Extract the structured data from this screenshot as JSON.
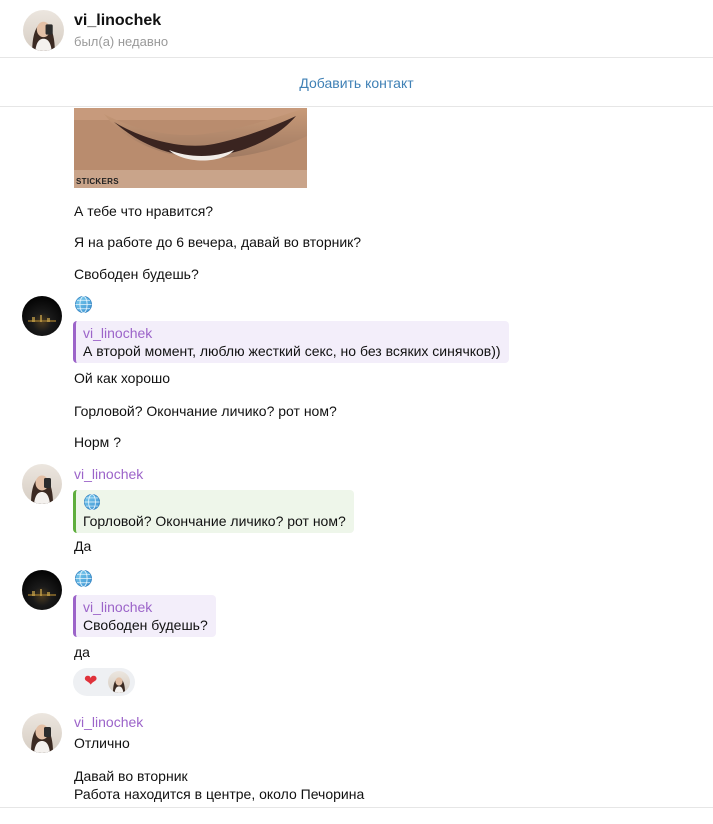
{
  "header": {
    "name": "vi_linochek",
    "status": "был(а) недавно"
  },
  "add_contact_label": "Добавить контакт",
  "sticker": {
    "caption": "STICKERS"
  },
  "messages": {
    "m1": "А тебе что нравится?",
    "m2": "Я на работе до 6 вечера, давай во вторник?",
    "m3": "Свободен будешь?",
    "m4": "Ой как хорошо",
    "m5": "Горловой? Окончание личико? рот ном?",
    "m6": "Норм ?",
    "m7": "Да",
    "m8": "да",
    "m9": "Отлично",
    "m10": "Давай во вторник",
    "m11": "Работа находится в центре, около Печорина"
  },
  "senders": {
    "s1": "vi_linochek",
    "s2": "vi_linochek"
  },
  "quotes": {
    "q1": {
      "name": "vi_linochek",
      "text": "А второй момент, люблю жесткий секс, но без всяких синячков))"
    },
    "q2": {
      "text": "Горловой? Окончание личико? рот ном?"
    },
    "q3": {
      "name": "vi_linochek",
      "text": "Свободен будешь?"
    }
  },
  "reaction": {
    "emoji": "heart-icon",
    "glyph": "❤"
  },
  "icons": {
    "globe": "globe-icon",
    "avatar_girl": "user-avatar-photo",
    "avatar_dark": "night-city-avatar"
  },
  "colors": {
    "accent_link": "#3f80b5",
    "sender_name": "#9c64c9",
    "quote_bar": "#9c64c9",
    "quote_bar_green": "#5fae3d",
    "heart": "#e0323b"
  }
}
